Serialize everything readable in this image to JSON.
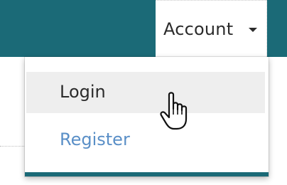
{
  "navbar": {
    "account_label": "Account",
    "bar_color": "#1b6a77"
  },
  "dropdown": {
    "items": [
      {
        "label": "Login",
        "state": "hover"
      },
      {
        "label": "Register",
        "color": "#5a8fc7"
      }
    ]
  },
  "cursor": {
    "icon": "hand-pointer-icon"
  }
}
